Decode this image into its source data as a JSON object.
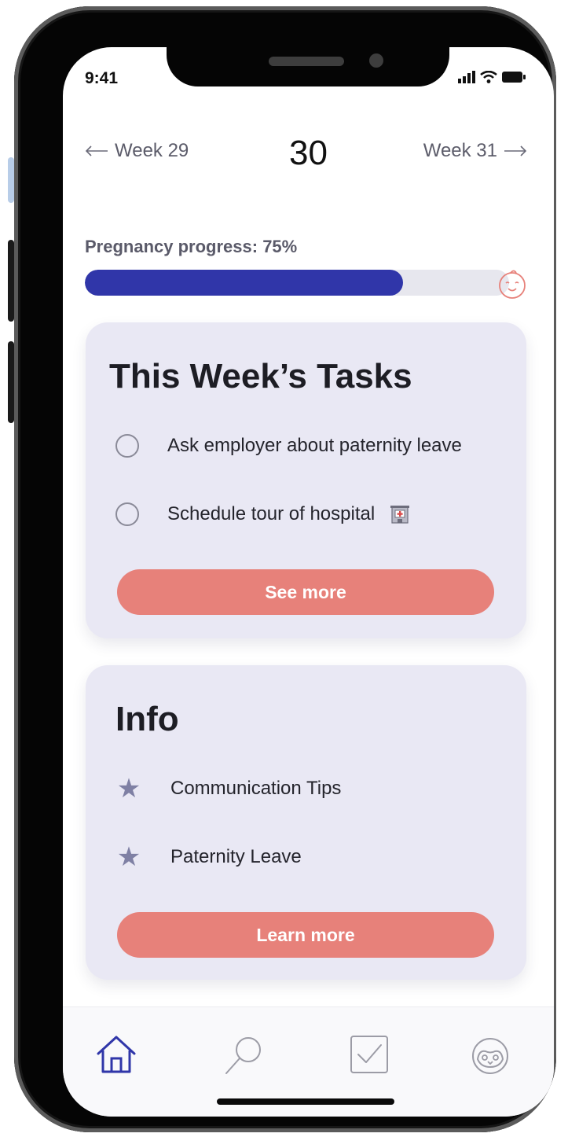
{
  "status_bar": {
    "time": "9:41"
  },
  "week_nav": {
    "prev_label": "Week 29",
    "current_week": "30",
    "next_label": "Week 31"
  },
  "progress": {
    "label": "Pregnancy progress: 75%",
    "percent": 75
  },
  "tasks_card": {
    "title": "This Week’s Tasks",
    "items": [
      {
        "label": "Ask employer about paternity leave"
      },
      {
        "label": "Schedule tour of hospital"
      }
    ],
    "button_label": "See more"
  },
  "info_card": {
    "title": "Info",
    "items": [
      {
        "label": "Communication Tips"
      },
      {
        "label": "Paternity Leave"
      }
    ],
    "button_label": "Learn more"
  },
  "tabs": [
    {
      "name": "home-icon",
      "active": true
    },
    {
      "name": "search-icon",
      "active": false
    },
    {
      "name": "checklist-icon",
      "active": false
    },
    {
      "name": "penguin-icon",
      "active": false
    }
  ],
  "colors": {
    "accent": "#3036a9",
    "button": "#e7817a",
    "card": "#e9e8f4"
  }
}
